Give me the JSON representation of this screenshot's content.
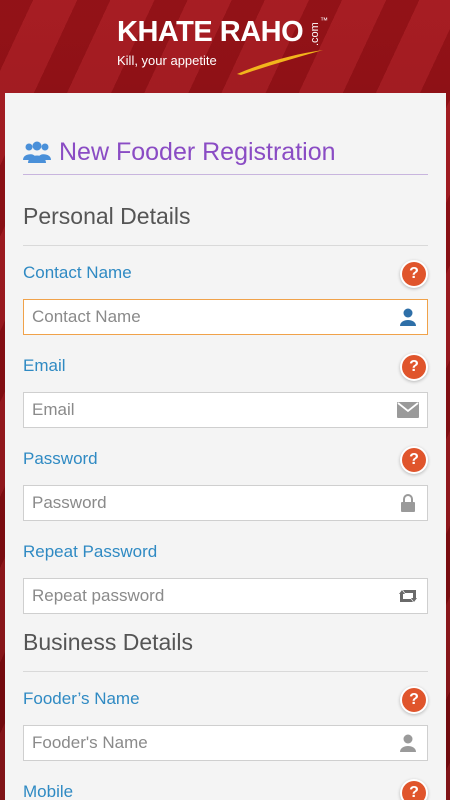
{
  "brand": {
    "name": "KHATE RAHO",
    "com": ".com",
    "tm": "™",
    "tagline": "Kill, your appetite"
  },
  "form": {
    "title": "New Fooder Registration",
    "title_icon": "users-icon"
  },
  "sections": {
    "personal": "Personal Details",
    "business": "Business Details"
  },
  "fields": {
    "contact_name": {
      "label": "Contact Name",
      "placeholder": "Contact Name",
      "icon": "user-icon",
      "help": "?"
    },
    "email": {
      "label": "Email",
      "placeholder": "Email",
      "icon": "envelope-icon",
      "help": "?"
    },
    "password": {
      "label": "Password",
      "placeholder": "Password",
      "icon": "lock-icon",
      "help": "?"
    },
    "repeat_password": {
      "label": "Repeat Password",
      "placeholder": "Repeat password",
      "icon": "retweet-icon"
    },
    "fooder_name": {
      "label": "Fooder’s Name",
      "placeholder": "Fooder's Name",
      "icon": "user-icon",
      "help": "?"
    },
    "mobile": {
      "label": "Mobile",
      "help": "?"
    }
  },
  "colors": {
    "brand_red": "#8e0d12",
    "title_purple": "#8a4cc4",
    "label_blue": "#2f8ac3",
    "help_orange": "#e0552c",
    "focus_border": "#f0a24a"
  }
}
